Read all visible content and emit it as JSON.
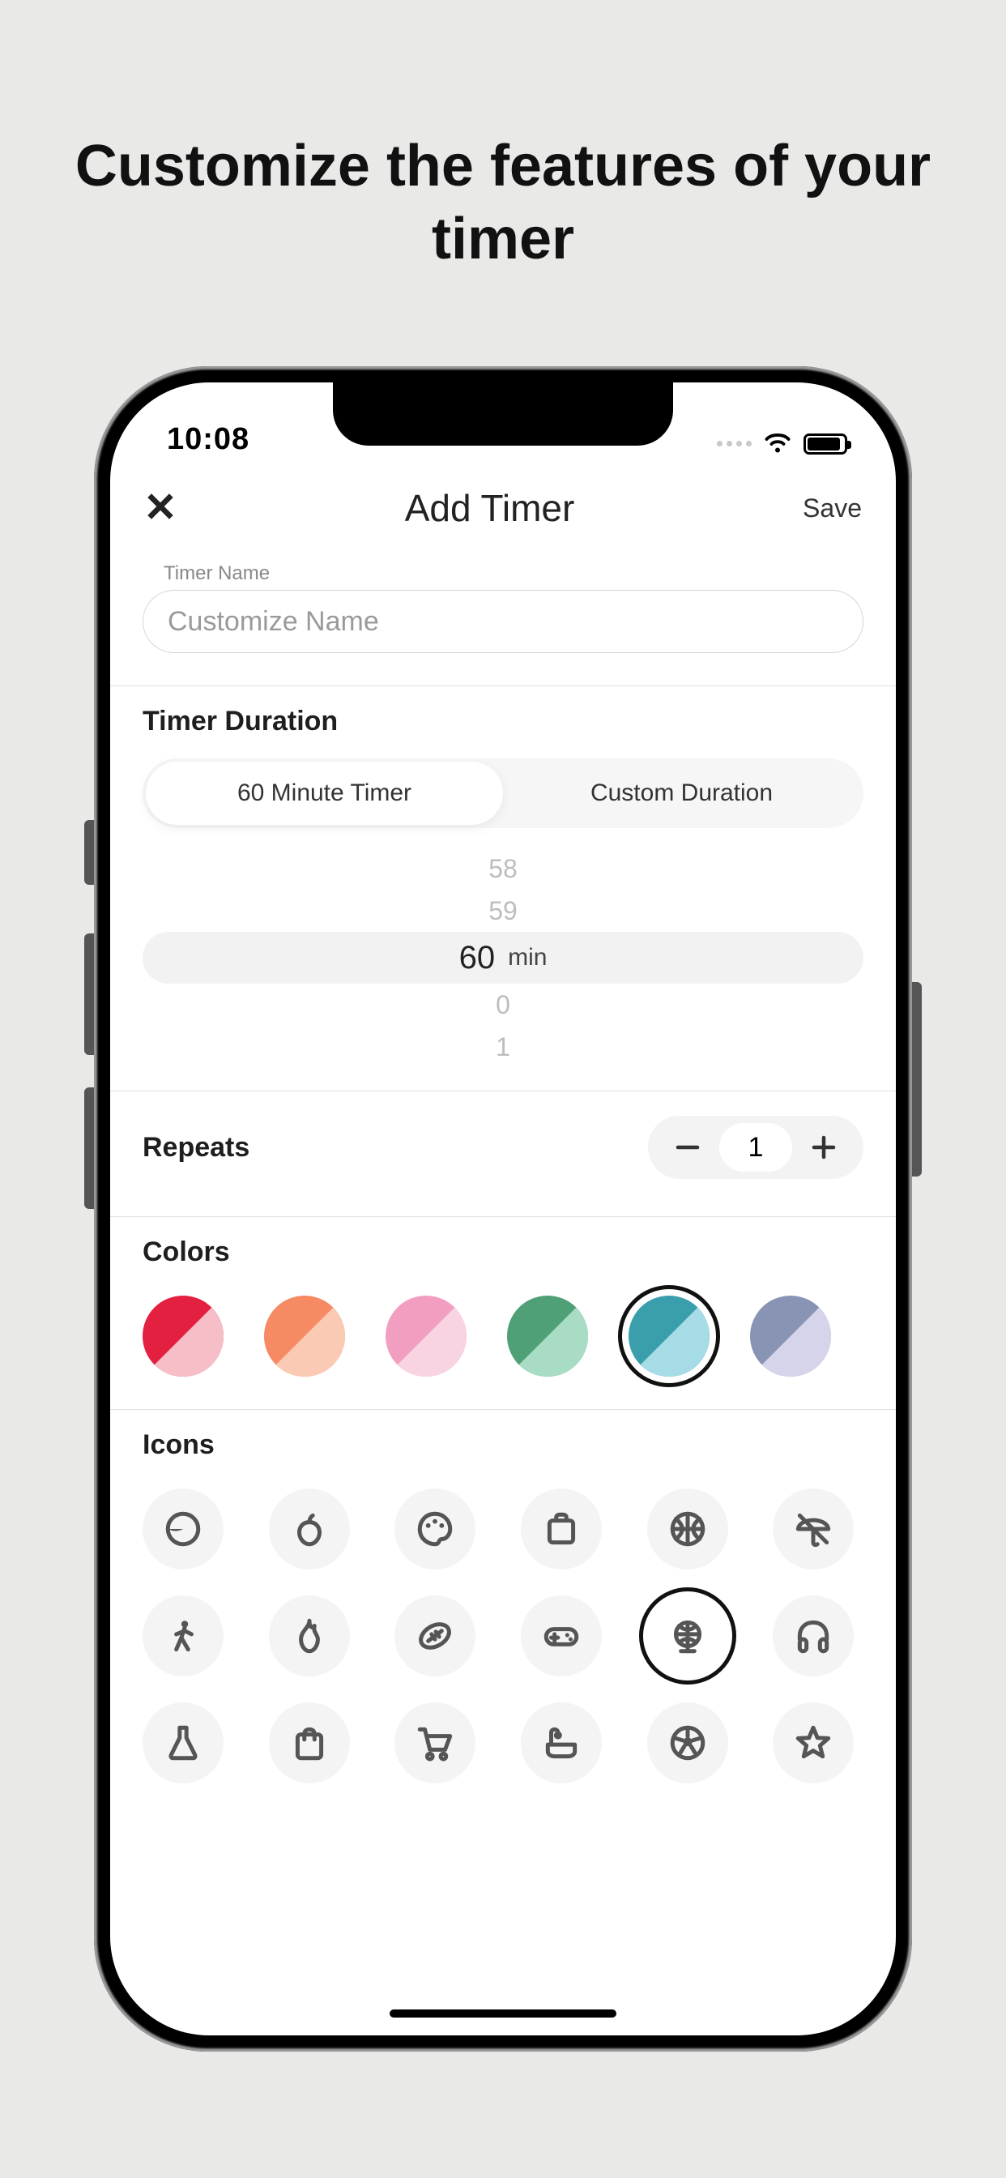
{
  "marketing": {
    "headline": "Customize the features of your timer"
  },
  "status": {
    "time": "10:08"
  },
  "nav": {
    "title": "Add Timer",
    "save_label": "Save"
  },
  "name_field": {
    "label": "Timer Name",
    "placeholder": "Customize Name",
    "value": ""
  },
  "duration": {
    "header": "Timer Duration",
    "tabs": {
      "preset": "60 Minute Timer",
      "custom": "Custom Duration",
      "active": "preset"
    },
    "picker": {
      "values": [
        "58",
        "59",
        "60",
        "0",
        "1"
      ],
      "selected": "60",
      "unit": "min"
    }
  },
  "repeats": {
    "header": "Repeats",
    "value": "1"
  },
  "colors": {
    "header": "Colors",
    "items": [
      {
        "name": "red",
        "a": "#e3203f",
        "b": "#f6bfc8",
        "selected": false
      },
      {
        "name": "coral",
        "a": "#f68a63",
        "b": "#facab4",
        "selected": false
      },
      {
        "name": "pink",
        "a": "#f29ec1",
        "b": "#f8d4e3",
        "selected": false
      },
      {
        "name": "green",
        "a": "#4f9f77",
        "b": "#a9dcc5",
        "selected": false
      },
      {
        "name": "teal",
        "a": "#3a9eac",
        "b": "#a6dce6",
        "selected": true
      },
      {
        "name": "violet",
        "a": "#8994b4",
        "b": "#d6d4ea",
        "selected": false
      }
    ]
  },
  "icons": {
    "header": "Icons",
    "items": [
      "timer",
      "apple",
      "palette",
      "briefcase",
      "basketball",
      "umbrella",
      "walk",
      "fire",
      "football",
      "gamepad",
      "globe",
      "headphones",
      "flask",
      "shopping-bag",
      "cart",
      "bathtub",
      "soccer",
      "star"
    ],
    "selected": "globe"
  }
}
